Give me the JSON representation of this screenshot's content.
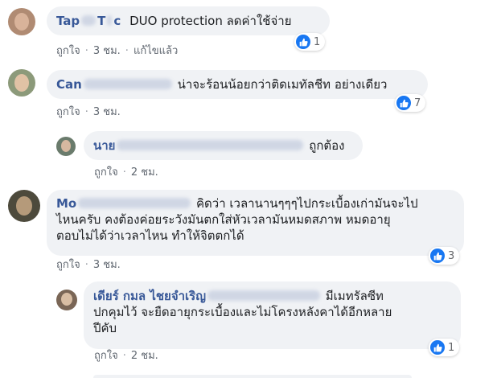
{
  "common": {
    "like_label": "ถูกใจ",
    "dot": "·"
  },
  "comments": [
    {
      "name_visible_start": "Tap",
      "name_visible_end": "T",
      "name_visible_tail": "c",
      "text": "DUO protection ลดค่าใช้จ่าย",
      "time": "3 ชม.",
      "edited": "แก้ไขแล้ว",
      "reactions": "1"
    },
    {
      "name_visible_start": "Can",
      "text": "น่าจะร้อนน้อยกว่าติดเมทัลชีท อย่างเดียว",
      "time": "3 ชม.",
      "reactions": "7"
    },
    {
      "name_visible_start": "นาย",
      "text": "ถูกต้อง",
      "time": "2 ชม."
    },
    {
      "name_visible_start": "Mo",
      "text_line1": "คิดว่า เวลานานๆๆๆไปกระเบื้องเก่ามันจะไป",
      "text_line2": "ไหนครับ คงต้องค่อยระวังมันตกใส่หัวเวลามันหมดสภาพ หมดอายุ",
      "text_line3": "ตอบไม่ได้ว่าเวลาไหน ทำให้จิตตกได้",
      "time": "3 ชม.",
      "reactions": "3"
    },
    {
      "name_visible_start": "เดียร์ กมล ไชยจำเริญ",
      "text_line1": "มีเมทรัลซีท",
      "text_line2": "ปกคุมไว้ จะยืดอายุกระเบื้องและไม่โครงหลังคาได้อีกหลาย",
      "text_line3": "ปีคับ",
      "time": "2 ชม.",
      "reactions": "1"
    }
  ],
  "colors": {
    "bubble": "#f0f2f5",
    "name": "#385898",
    "like": "#1877f2",
    "meta": "#606770"
  },
  "icons": {
    "reaction": "thumbs-up-icon"
  }
}
